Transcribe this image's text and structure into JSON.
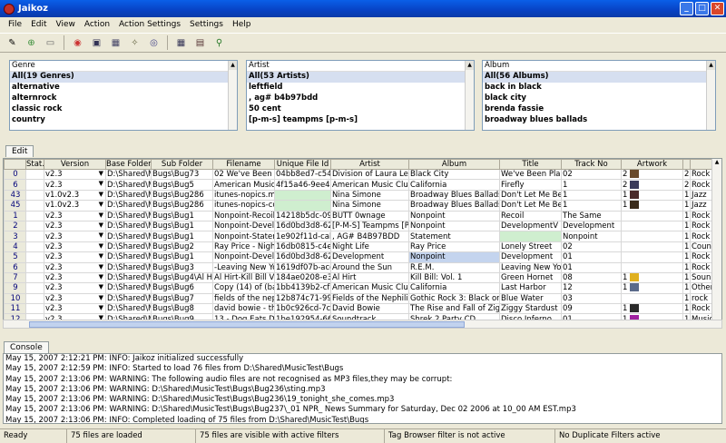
{
  "window": {
    "title": "Jaikoz"
  },
  "menu": [
    "File",
    "Edit",
    "View",
    "Action",
    "Action Settings",
    "Settings",
    "Help"
  ],
  "toolbar_icons": [
    "new-icon",
    "open-icon",
    "save-icon",
    "car-icon",
    "record-icon",
    "tag-icon",
    "wand-icon",
    "cd-icon",
    "grid-icon",
    "edit-icon",
    "search-icon"
  ],
  "filters": {
    "genre": {
      "header": "Genre",
      "items": [
        "All(19 Genres)",
        "alternative",
        "alternrock",
        "classic rock",
        "country"
      ]
    },
    "artist": {
      "header": "Artist",
      "items": [
        "All(53 Artists)",
        "leftfield",
        ", ag# b4b97bdd",
        "50 cent",
        "[p-m-s] teampms [p-m-s]"
      ]
    },
    "album": {
      "header": "Album",
      "items": [
        "All(56 Albums)",
        "back in black",
        "black city",
        "brenda fassie",
        "broadway blues ballads"
      ]
    }
  },
  "tabs": {
    "edit": "Edit",
    "console": "Console"
  },
  "grid": {
    "columns": [
      "",
      "Stat.",
      "Version",
      "Base Folder",
      "Sub Folder",
      "Filename",
      "Unique File Id",
      "Artist",
      "Album",
      "Title",
      "Track No",
      "Artwork",
      "",
      ""
    ],
    "rows": [
      [
        "0",
        "",
        "v2.3",
        "D:\\Shared\\Mu",
        "Bugs\\Bug73",
        "02 We've Been Pl",
        "04bb8ed7-c549",
        "Division of Laura Lee",
        "Black City",
        "We've Been Plann",
        "02",
        "2",
        "2",
        "Rock"
      ],
      [
        "6",
        "",
        "v2.3",
        "D:\\Shared\\Mu",
        "Bugs\\Bug5",
        "American Music C",
        "4f15a46-9ee4",
        "American Music Club",
        "California",
        "Firefly",
        "1",
        "2",
        "2",
        "Rock"
      ],
      [
        "43",
        "",
        "v1.0v2.3",
        "D:\\Shared\\Mu",
        "Bugs\\Bug286",
        "itunes-nopics.mp",
        "",
        "Nina Simone",
        "Broadway Blues Ballads",
        "Don't Let Me Be M",
        "1",
        "1",
        "1",
        "Jazz"
      ],
      [
        "45",
        "",
        "v1.0v2.3",
        "D:\\Shared\\Mu",
        "Bugs\\Bug286",
        "itunes-nopics-cop",
        "",
        "Nina Simone",
        "Broadway Blues Ballads",
        "Don't Let Me Be M",
        "1",
        "1",
        "1",
        "Jazz"
      ],
      [
        "1",
        "",
        "v2.3",
        "D:\\Shared\\Mu",
        "Bugs\\Bug1",
        "Nonpoint-Recoil-C",
        "14218b5dc-093f",
        "BUTT 0wnage",
        "Nonpoint",
        "Recoil",
        "The Same",
        "",
        "1",
        "Rock"
      ],
      [
        "2",
        "",
        "v2.3",
        "D:\\Shared\\Mu",
        "Bugs\\Bug1",
        "Nonpoint-Develop",
        "16d0bd3d8-622b",
        "[P-M-S] Teampms [P-M",
        "Nonpoint",
        "DevelopmentV",
        "Development",
        "",
        "1",
        "Rock"
      ],
      [
        "3",
        "",
        "v2.3",
        "D:\\Shared\\Mu",
        "Bugs\\Bug1",
        "Nonpoint-Statemt",
        "1e902f11d-cab0-",
        ", AG# B4B97BDD",
        "Statement",
        "",
        "Nonpoint",
        "",
        "1",
        "Rock"
      ],
      [
        "4",
        "",
        "v2.3",
        "D:\\Shared\\Mu",
        "Bugs\\Bug2",
        "Ray Price - Night L",
        "16db0815-c4ef-",
        "Night Life",
        "Ray Price",
        "Lonely Street",
        "02",
        "",
        "1",
        "Coun"
      ],
      [
        "5",
        "",
        "v2.3",
        "D:\\Shared\\Mu",
        "Bugs\\Bug1",
        "Nonpoint-Develop",
        "16d0bd3d8-622b",
        "Development",
        "Nonpoint",
        "Development",
        "01",
        "",
        "1",
        "Rock"
      ],
      [
        "6",
        "",
        "v2.3",
        "D:\\Shared\\Mu",
        "Bugs\\Bug3",
        "-Leaving New York",
        "1619df07b-acc6-",
        "Around the Sun",
        "R.E.M.",
        "Leaving New York",
        "01",
        "",
        "1",
        "Rock"
      ],
      [
        "7",
        "",
        "v2.3",
        "D:\\Shared\\Mu",
        "Bugs\\Bug4\\Al Hirt",
        "Al Hirt-Kill Bill Vol",
        "184ae0208-e39f",
        "Al Hirt",
        "Kill Bill: Vol. 1",
        "Green Hornet",
        "08",
        "1",
        "1",
        "Soun"
      ],
      [
        "9",
        "",
        "v2.3",
        "D:\\Shared\\Mu",
        "Bugs\\Bug6",
        "Copy (14) of (back",
        "1bb4139b2-cf71-",
        "American Music Club",
        "California",
        "Last Harbor",
        "12",
        "1",
        "1",
        "Other"
      ],
      [
        "10",
        "",
        "v2.3",
        "D:\\Shared\\Mu",
        "Bugs\\Bug7",
        "fields of the nephili",
        "12b874c71-9947",
        "Fields of the Nephilim",
        "Gothic Rock 3: Black on Bla",
        "Blue Water",
        "03",
        "",
        "1",
        "rock"
      ],
      [
        "11",
        "",
        "v2.3",
        "D:\\Shared\\Mu",
        "Bugs\\Bug8",
        "david bowie - the r",
        "1b0c926cd-7c82-",
        "David Bowie",
        "The Rise and Fall of Ziggy",
        "Ziggy Stardust",
        "09",
        "1",
        "1",
        "Rock"
      ],
      [
        "12",
        "",
        "v2.3",
        "D:\\Shared\\Mu",
        "Bugs\\Bug9",
        "13 - Dog Eats Dog",
        "1be192954-6618",
        "Soundtrack",
        "Shrek 2 Party CD",
        "Disco Inferno",
        "01",
        "1",
        "1",
        "Music"
      ]
    ]
  },
  "console": [
    "May 15, 2007 2:12:21 PM: INFO: Jaikoz initialized successfully",
    "May 15, 2007 2:12:59 PM: INFO: Started to load 76 files from D:\\Shared\\MusicTest\\Bugs",
    "May 15, 2007 2:13:06 PM: WARNING: The following audio files are not recognised as MP3 files,they may be corrupt:",
    "May 15, 2007 2:13:06 PM: WARNING: D:\\Shared\\MusicTest\\Bugs\\Bug236\\sting.mp3",
    "May 15, 2007 2:13:06 PM: WARNING: D:\\Shared\\MusicTest\\Bugs\\Bug236\\19_tonight_she_comes.mp3",
    "May 15, 2007 2:13:06 PM: WARNING: D:\\Shared\\MusicTest\\Bugs\\Bug237\\_01 NPR_ News Summary for Saturday, Dec 02 2006 at 10_00 AM EST.mp3",
    "May 15, 2007 2:13:06 PM: INFO: Completed loading of 75 files from D:\\Shared\\MusicTest\\Bugs"
  ],
  "status": [
    "Ready",
    "75 files are loaded",
    "75 files are visible with active filters",
    "Tag Browser filter is not active",
    "No Duplicate Filters active"
  ]
}
